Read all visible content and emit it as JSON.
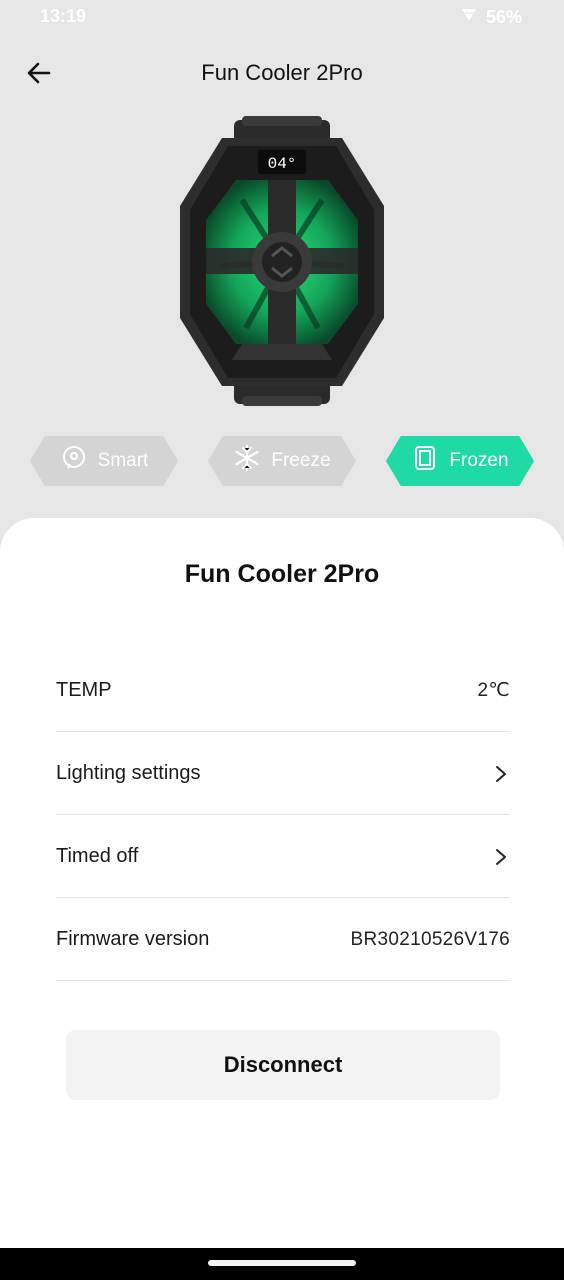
{
  "status_bar": {
    "time": "13:19",
    "battery": "56%",
    "icons": [
      "wifi-icon",
      "battery-icon"
    ]
  },
  "header": {
    "title": "Fun Cooler 2Pro",
    "back_icon": "arrow-left-icon"
  },
  "device": {
    "display_text": "04°"
  },
  "modes": [
    {
      "label": "Smart",
      "icon": "smart-icon",
      "active": false
    },
    {
      "label": "Freeze",
      "icon": "snowflake-icon",
      "active": false
    },
    {
      "label": "Frozen",
      "icon": "frozen-icon",
      "active": true
    }
  ],
  "sheet": {
    "title": "Fun Cooler 2Pro",
    "rows": [
      {
        "label": "TEMP",
        "value": "2℃"
      },
      {
        "label": "Lighting settings",
        "value": ""
      },
      {
        "label": "Timed off",
        "value": ""
      },
      {
        "label": "Firmware version",
        "value": "BR30210526V176"
      }
    ],
    "disconnect_label": "Disconnect"
  },
  "colors": {
    "accent": "#1fd9a6",
    "background": "#e6e6e6",
    "mode_inactive": "#d4d4d4",
    "device_glow": "#1aa85a"
  }
}
